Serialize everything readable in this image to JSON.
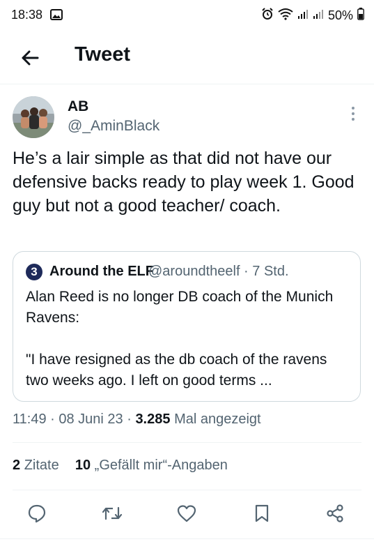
{
  "status_bar": {
    "time": "18:38",
    "battery": "50%",
    "icons": [
      "gallery-icon",
      "alarm-icon",
      "wifi-icon",
      "signal-icon",
      "signal-icon",
      "battery-icon"
    ]
  },
  "header": {
    "title": "Tweet"
  },
  "tweet": {
    "author_name": "AB",
    "author_handle": "@_AminBlack",
    "text": "He’s a lair simple as that did not have our defensive backs ready to play week 1. Good guy but not a good teacher/ coach.",
    "quote": {
      "badge": "3",
      "author_name": "Around the ELF",
      "author_handle": "@aroundtheelf · 7 Std.",
      "line1": "Alan Reed is no longer DB coach of the Munich Ravens:",
      "line2": "\"I have resigned as the db coach of the ravens two weeks ago. I left on good terms ..."
    },
    "meta": {
      "time": "11:49",
      "date": "08 Juni 23",
      "views": "3.285",
      "views_label": "Mal angezeigt"
    },
    "stats": {
      "quotes": "2",
      "quotes_label": "Zitate",
      "likes": "10",
      "likes_label": "„Gefällt mir“-Angaben"
    }
  },
  "colors": {
    "text": "#0f1419",
    "secondary": "#536471",
    "accent": "#1d9bf0",
    "border": "#cfd9de"
  }
}
